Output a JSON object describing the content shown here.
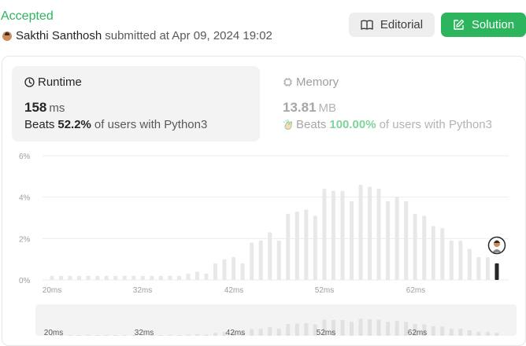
{
  "header": {
    "status": "Accepted",
    "username": "Sakthi Santhosh",
    "submitted_text": "submitted at Apr 09, 2024 19:02",
    "editorial_label": "Editorial",
    "solution_label": "Solution"
  },
  "runtime": {
    "title": "Runtime",
    "value": "158",
    "unit": "ms",
    "beats_word": "Beats",
    "beats_pct": "52.2%",
    "beats_suffix": "of users with Python3"
  },
  "memory": {
    "title": "Memory",
    "value": "13.81",
    "unit": "MB",
    "beats_word": "Beats",
    "beats_pct": "100.00%",
    "beats_suffix": "of users with Python3"
  },
  "colors": {
    "accent_green": "#2db55d",
    "bar": "#e8e8e8",
    "highlight_bar": "#262626"
  },
  "icons": {
    "editorial": "book-icon",
    "solution": "edit-icon",
    "runtime": "clock-icon",
    "memory": "chip-icon",
    "beats": "clap-icon"
  },
  "chart_data": {
    "type": "bar",
    "xlabel": "",
    "ylabel": "",
    "ylim": [
      0,
      6
    ],
    "yticks": [
      "0%",
      "2%",
      "4%",
      "6%"
    ],
    "xtick_labels": [
      "20ms",
      "32ms",
      "42ms",
      "52ms",
      "62ms"
    ],
    "values": [
      0.2,
      0.2,
      0.2,
      0.2,
      0.2,
      0.2,
      0.2,
      0.2,
      0.2,
      0.2,
      0.2,
      0.2,
      0.2,
      0.2,
      0.2,
      0.3,
      0.4,
      0.3,
      0.8,
      1.0,
      1.1,
      0.8,
      1.8,
      1.9,
      2.3,
      1.9,
      3.2,
      3.3,
      3.4,
      3.1,
      4.4,
      4.3,
      4.3,
      3.8,
      4.6,
      4.5,
      4.4,
      3.8,
      4.0,
      3.8,
      3.2,
      3.1,
      2.6,
      2.5,
      1.9,
      1.9,
      1.5,
      1.1,
      1.1,
      0.8
    ],
    "highlighted_value": 0.8,
    "overview_values": [
      0.2,
      0.2,
      0.2,
      0.2,
      0.2,
      0.2,
      0.2,
      0.2,
      0.2,
      0.2,
      0.2,
      0.2,
      0.2,
      0.2,
      0.2,
      0.3,
      0.4,
      0.3,
      0.8,
      1.0,
      1.1,
      0.8,
      1.8,
      1.9,
      2.3,
      1.9,
      3.2,
      3.3,
      3.4,
      3.1,
      4.4,
      4.3,
      4.3,
      3.8,
      4.6,
      4.5,
      4.4,
      3.8,
      4.0,
      3.8,
      3.2,
      3.1,
      2.6,
      2.5,
      1.9,
      1.9,
      1.5,
      1.1,
      1.1,
      0.8
    ]
  }
}
